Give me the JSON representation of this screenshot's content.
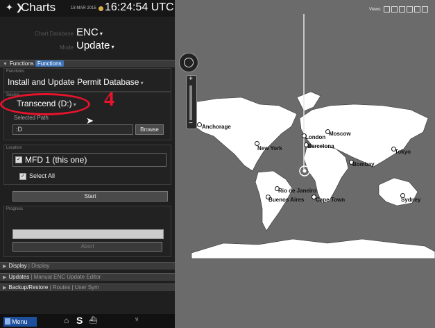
{
  "header": {
    "title": "Charts",
    "date": "18 MAR 2015",
    "time": "16:24:54 UTC"
  },
  "chart_database": {
    "label": "Chart Database",
    "value": "ENC"
  },
  "mode": {
    "label": "Mode",
    "value": "Update"
  },
  "functions_section": {
    "title": "Functions",
    "tag": "Functions"
  },
  "functions_box": {
    "label": "Functions",
    "value": "Install and Update Permit Database"
  },
  "source": {
    "label": "Source",
    "value": "Transcend (D:)"
  },
  "annotation": {
    "number": "4"
  },
  "selected_path": {
    "label": "Selected Path",
    "value": ":D",
    "browse": "Browse"
  },
  "location": {
    "label": "Location",
    "value": "MFD 1 (this one)",
    "select_all": "Select All"
  },
  "start_button": "Start",
  "progress": {
    "label": "Progress",
    "abort": "Abort",
    "fraction": 0
  },
  "collapsed_sections": [
    {
      "title": "Display",
      "sub": "| Display"
    },
    {
      "title": "Updates",
      "sub": "| Manual ENC Update Editor"
    },
    {
      "title": "Backup/Restore",
      "sub": "| Routes | User Sym"
    }
  ],
  "bottom": {
    "menu": "Menu",
    "s": "S"
  },
  "views": {
    "label": "Views:"
  },
  "map": {
    "cities": [
      "Anchorage",
      "New York",
      "London",
      "Moscow",
      "Barcelona",
      "Bombay",
      "Tokyo",
      "Rio de Janeiro",
      "Buenos Aires",
      "Cape Town",
      "Sydney"
    ]
  },
  "colors": {
    "accent": "#3f73b8",
    "annotation": "#e8132c",
    "map_bg": "#6b6b6b",
    "land": "#ffffff"
  }
}
